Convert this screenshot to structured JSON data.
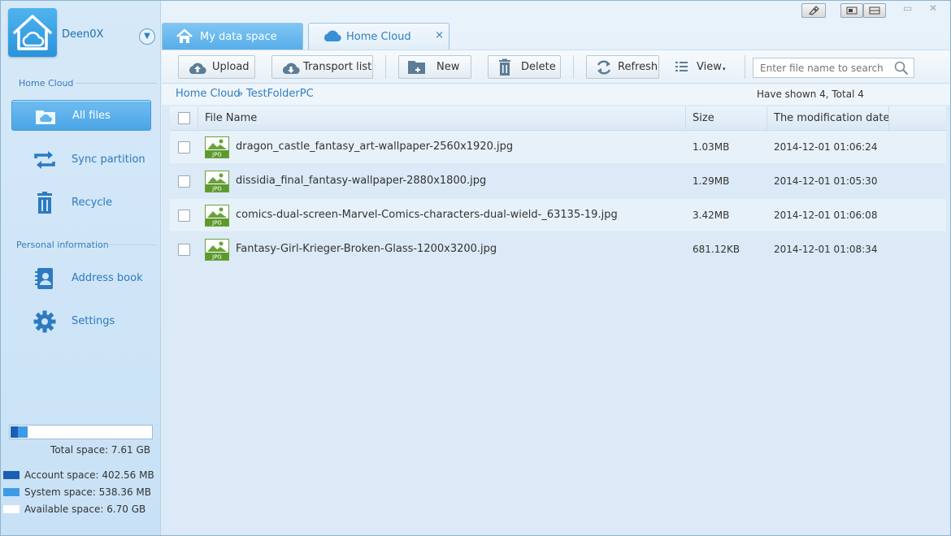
{
  "sidebar": {
    "username": "Deen0X",
    "section_home": "Home Cloud",
    "section_personal": "Personal information",
    "items": [
      {
        "label": "All files",
        "icon": "folder-cloud-icon",
        "active": true
      },
      {
        "label": "Sync partition",
        "icon": "sync-icon"
      },
      {
        "label": "Recycle",
        "icon": "trash-icon"
      },
      {
        "label": "Address book",
        "icon": "address-book-icon"
      },
      {
        "label": "Settings",
        "icon": "gear-icon"
      }
    ],
    "storage": {
      "total_label": "Total space: 7.61 GB",
      "account_label": "Account space: 402.56 MB",
      "system_label": "System space: 538.36 MB",
      "available_label": "Available space: 6.70 GB",
      "account_fraction": 0.052,
      "system_fraction": 0.069,
      "colors": {
        "account": "#1a5fb4",
        "system": "#3d9be6",
        "available": "#ffffff"
      }
    }
  },
  "tabs": [
    {
      "label": "My data space",
      "icon": "home-icon",
      "active": false
    },
    {
      "label": "Home Cloud",
      "icon": "cloud-icon",
      "active": true,
      "close": "×"
    }
  ],
  "toolbar": {
    "upload": "Upload",
    "transport_list": "Transport list",
    "new": "New",
    "delete": "Delete",
    "refresh": "Refresh",
    "view": "View",
    "search_placeholder": "Enter file name to search"
  },
  "breadcrumb": {
    "root": "Home Cloud",
    "separator": "»",
    "current": "TestFolderPC",
    "count": "Have shown 4, Total 4"
  },
  "table": {
    "columns": {
      "name": "File Name",
      "size": "Size",
      "date": "The modification date"
    },
    "rows": [
      {
        "name": "dragon_castle_fantasy_art-wallpaper-2560x1920.jpg",
        "size": "1.03MB",
        "date": "2014-12-01 01:06:24",
        "type": "JPG"
      },
      {
        "name": "dissidia_final_fantasy-wallpaper-2880x1800.jpg",
        "size": "1.29MB",
        "date": "2014-12-01 01:05:30",
        "type": "JPG"
      },
      {
        "name": "comics-dual-screen-Marvel-Comics-characters-dual-wield-_63135-19.jpg",
        "size": "3.42MB",
        "date": "2014-12-01 01:06:08",
        "type": "JPG"
      },
      {
        "name": "Fantasy-Girl-Krieger-Broken-Glass-1200x3200.jpg",
        "size": "681.12KB",
        "date": "2014-12-01 01:08:34",
        "type": "JPG"
      }
    ]
  }
}
